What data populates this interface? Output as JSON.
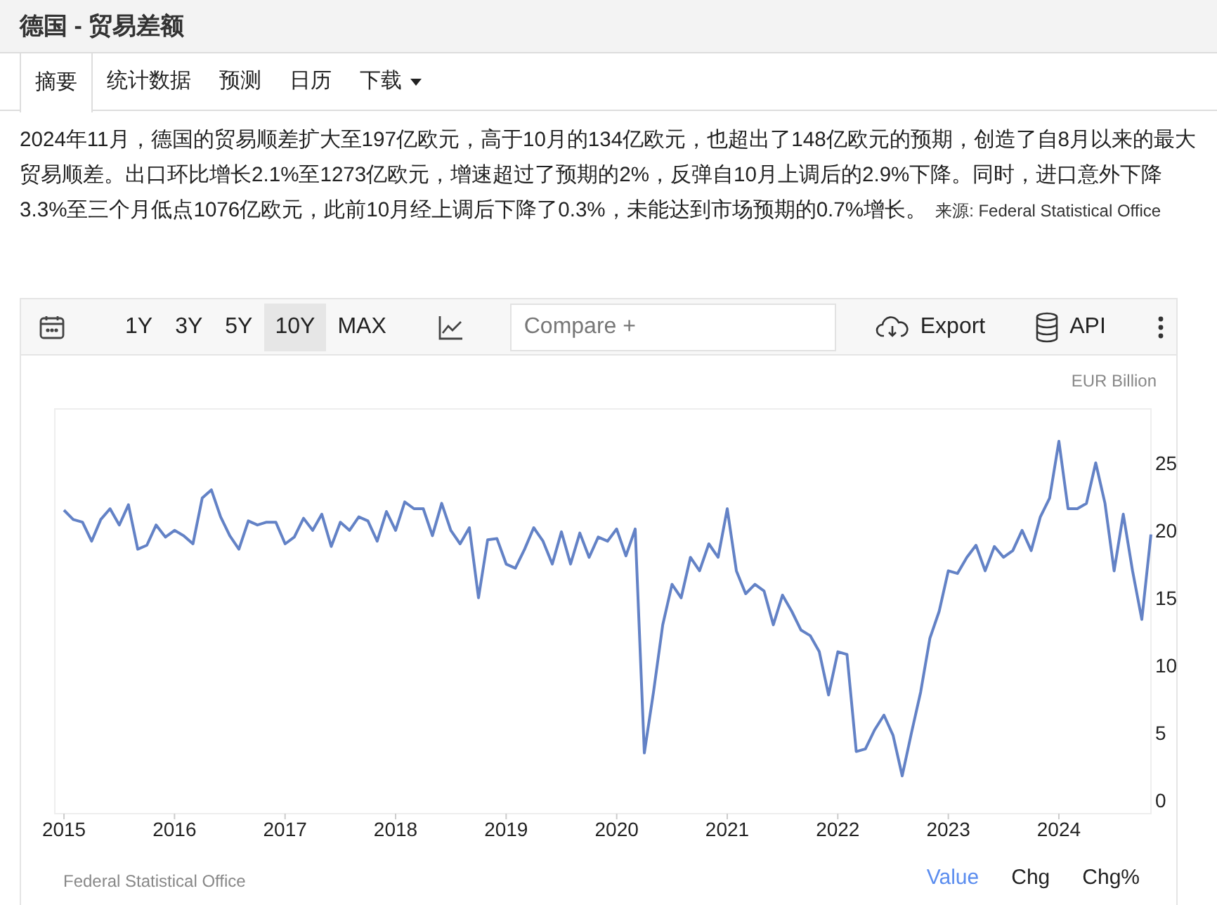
{
  "title": "德国 - 贸易差额",
  "tabs": [
    {
      "label": "摘要",
      "selected": true,
      "dropdown": false
    },
    {
      "label": "统计数据",
      "selected": false,
      "dropdown": false
    },
    {
      "label": "预测",
      "selected": false,
      "dropdown": false
    },
    {
      "label": "日历",
      "selected": false,
      "dropdown": false
    },
    {
      "label": "下载",
      "selected": false,
      "dropdown": true
    }
  ],
  "summary": "2024年11月，德国的贸易顺差扩大至197亿欧元，高于10月的134亿欧元，也超出了148亿欧元的预期，创造了自8月以来的最大贸易顺差。出口环比增长2.1%至1273亿欧元，增速超过了预期的2%，反弹自10月上调后的2.9%下降。同时，进口意外下降3.3%至三个月低点1076亿欧元，此前10月经上调后下降了0.3%，未能达到市场预期的0.7%增长。",
  "source": "来源: Federal Statistical Office",
  "toolbar": {
    "ranges": [
      {
        "label": "1Y",
        "selected": false
      },
      {
        "label": "3Y",
        "selected": false
      },
      {
        "label": "5Y",
        "selected": false
      },
      {
        "label": "10Y",
        "selected": true
      },
      {
        "label": "MAX",
        "selected": false
      }
    ],
    "compare_placeholder": "Compare +",
    "export": "Export",
    "api": "API"
  },
  "chart": {
    "unit": "EUR Billion",
    "chart_data": {
      "type": "line",
      "ylim": [
        -1,
        29
      ],
      "xlim": [
        2014.917,
        2024.833
      ],
      "x": [
        2015,
        2015.083,
        2015.167,
        2015.25,
        2015.333,
        2015.417,
        2015.5,
        2015.583,
        2015.667,
        2015.75,
        2015.833,
        2015.917,
        2016,
        2016.083,
        2016.167,
        2016.25,
        2016.333,
        2016.417,
        2016.5,
        2016.583,
        2016.667,
        2016.75,
        2016.833,
        2016.917,
        2017,
        2017.083,
        2017.167,
        2017.25,
        2017.333,
        2017.417,
        2017.5,
        2017.583,
        2017.667,
        2017.75,
        2017.833,
        2017.917,
        2018,
        2018.083,
        2018.167,
        2018.25,
        2018.333,
        2018.417,
        2018.5,
        2018.583,
        2018.667,
        2018.75,
        2018.833,
        2018.917,
        2019,
        2019.083,
        2019.167,
        2019.25,
        2019.333,
        2019.417,
        2019.5,
        2019.583,
        2019.667,
        2019.75,
        2019.833,
        2019.917,
        2020,
        2020.083,
        2020.167,
        2020.25,
        2020.333,
        2020.417,
        2020.5,
        2020.583,
        2020.667,
        2020.75,
        2020.833,
        2020.917,
        2021,
        2021.083,
        2021.167,
        2021.25,
        2021.333,
        2021.417,
        2021.5,
        2021.583,
        2021.667,
        2021.75,
        2021.833,
        2021.917,
        2022,
        2022.083,
        2022.167,
        2022.25,
        2022.333,
        2022.417,
        2022.5,
        2022.583,
        2022.667,
        2022.75,
        2022.833,
        2022.917,
        2023,
        2023.083,
        2023.167,
        2023.25,
        2023.333,
        2023.417,
        2023.5,
        2023.583,
        2023.667,
        2023.75,
        2023.833,
        2023.917,
        2024,
        2024.083,
        2024.167,
        2024.25,
        2024.333,
        2024.417,
        2024.5,
        2024.583,
        2024.667,
        2024.75,
        2024.833
      ],
      "yticks": [
        0,
        5,
        10,
        15,
        20,
        25
      ],
      "xticks": [
        2015,
        2016,
        2017,
        2018,
        2019,
        2020,
        2021,
        2022,
        2023,
        2024
      ],
      "series": [
        {
          "color": "#6382c6",
          "values": [
            21.5,
            20.8,
            20.6,
            19.2,
            20.8,
            21.6,
            20.4,
            21.9,
            18.6,
            18.9,
            20.4,
            19.5,
            20.0,
            19.6,
            19.0,
            22.4,
            23.0,
            21.0,
            19.6,
            18.6,
            20.7,
            20.4,
            20.6,
            20.6,
            19.0,
            19.5,
            20.9,
            20.0,
            21.2,
            18.8,
            20.6,
            20.0,
            21.0,
            20.7,
            19.2,
            21.4,
            20.0,
            22.1,
            21.6,
            21.6,
            19.6,
            22.0,
            20.0,
            19.0,
            20.2,
            15.0,
            19.3,
            19.4,
            17.5,
            17.2,
            18.6,
            20.2,
            19.2,
            17.5,
            19.9,
            17.5,
            19.8,
            18.0,
            19.5,
            19.2,
            20.1,
            18.1,
            20.1,
            3.5,
            8.0,
            13.0,
            16.0,
            15.0,
            18.0,
            17.0,
            19.0,
            18.0,
            21.6,
            17.0,
            15.3,
            16.0,
            15.5,
            13.0,
            15.2,
            14.0,
            12.6,
            12.2,
            11.0,
            7.8,
            11.0,
            10.8,
            3.6,
            3.8,
            5.2,
            6.3,
            4.8,
            1.8,
            5.0,
            8.0,
            12.0,
            14.0,
            17.0,
            16.8,
            18.0,
            18.9,
            17.0,
            18.8,
            18.0,
            18.5,
            20.0,
            18.5,
            21.0,
            22.4,
            26.6,
            21.6,
            21.6,
            22.0,
            25.0,
            22.0,
            17.0,
            21.2,
            17.0,
            13.4,
            19.7
          ]
        }
      ]
    },
    "footer_source": "Federal Statistical Office",
    "views": [
      {
        "label": "Value",
        "selected": true
      },
      {
        "label": "Chg",
        "selected": false
      },
      {
        "label": "Chg%",
        "selected": false
      }
    ]
  }
}
